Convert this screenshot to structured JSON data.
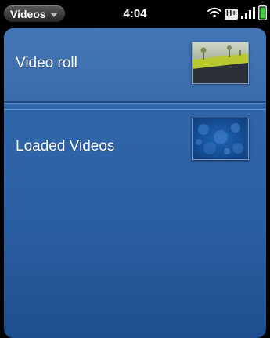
{
  "status_bar": {
    "app_menu_label": "Videos",
    "time": "4:04",
    "network_type": "H+",
    "icons": [
      "wifi-icon",
      "network-type-badge",
      "signal-bars-icon",
      "battery-icon"
    ]
  },
  "list": {
    "items": [
      {
        "label": "Video roll",
        "thumbnail": "outdoor-scene-thumbnail"
      },
      {
        "label": "Loaded Videos",
        "thumbnail": "blue-bokeh-thumbnail"
      }
    ]
  },
  "colors": {
    "background": "#2f65a9",
    "status_bar": "#000000",
    "battery": "#3ccf3c"
  }
}
